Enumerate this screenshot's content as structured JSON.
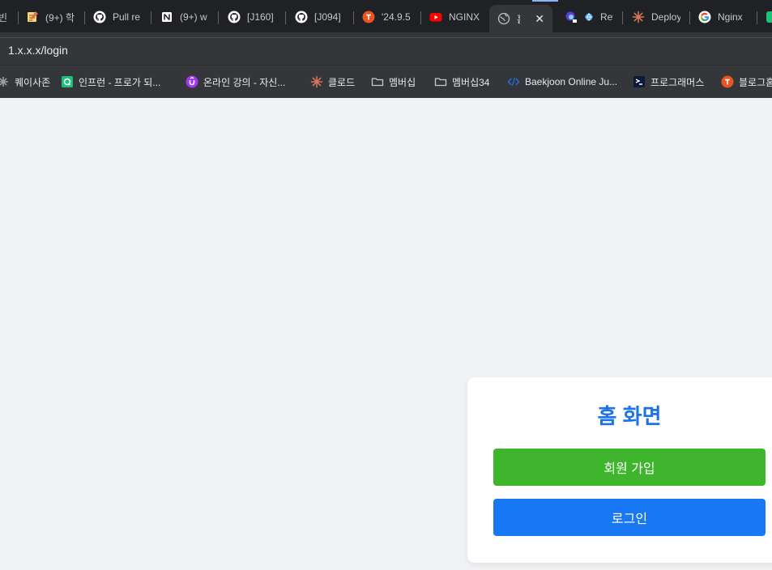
{
  "browser": {
    "tabs": [
      {
        "label": "빈",
        "icon": "generic-page-icon"
      },
      {
        "label": "(9+) 학",
        "icon": "memo-icon"
      },
      {
        "label": "Pull re",
        "icon": "github-icon"
      },
      {
        "label": "(9+) w",
        "icon": "notion-icon"
      },
      {
        "label": "[J160]",
        "icon": "github-icon"
      },
      {
        "label": "[J094]",
        "icon": "github-icon"
      },
      {
        "label": "'24.9.5",
        "icon": "tistory-icon"
      },
      {
        "label": "NGINX",
        "icon": "youtube-icon"
      },
      {
        "label": "홈",
        "icon": "globe-icon",
        "active": true
      },
      {
        "label": "Rev",
        "icon": "app-icon"
      },
      {
        "label": "Deploy",
        "icon": "claude-icon"
      },
      {
        "label": "Nginx",
        "icon": "google-icon"
      },
      {
        "label": "",
        "icon": "extension-icon"
      }
    ],
    "close_glyph": "✕",
    "url": "1.x.x.x/login",
    "bookmarks": [
      {
        "label": "퀘이사존",
        "icon": "quasarzone-icon"
      },
      {
        "label": "인프런 - 프로가 되...",
        "icon": "inflearn-icon"
      },
      {
        "label": "온라인 강의 - 자신...",
        "icon": "udemy-icon"
      },
      {
        "label": "클로드",
        "icon": "claude-icon"
      },
      {
        "label": "멤버십",
        "icon": "folder-icon"
      },
      {
        "label": "멤버십34",
        "icon": "folder-icon"
      },
      {
        "label": "Baekjoon Online Ju...",
        "icon": "code-icon"
      },
      {
        "label": "프로그래머스",
        "icon": "programmers-icon"
      },
      {
        "label": "블로그홈",
        "icon": "tistory-icon"
      }
    ]
  },
  "page": {
    "title": "홈 화면",
    "signup_label": "회원 가입",
    "login_label": "로그인"
  },
  "colors": {
    "accent": "#1a73e8",
    "signup": "#3eb52c",
    "login": "#1877f2",
    "background": "#f0f2f5"
  }
}
